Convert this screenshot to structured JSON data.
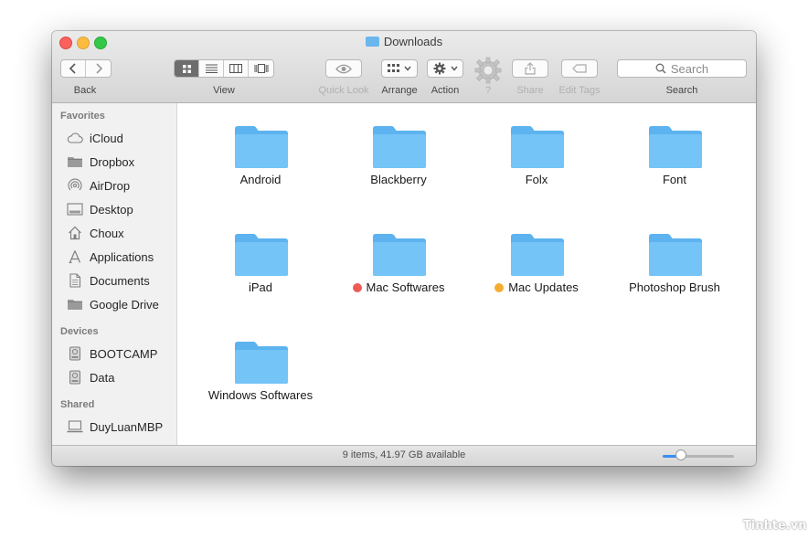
{
  "window": {
    "title": "Downloads"
  },
  "toolbar": {
    "back_label": "Back",
    "view_label": "View",
    "quicklook_label": "Quick Look",
    "arrange_label": "Arrange",
    "action_label": "Action",
    "unknown_label": "?",
    "share_label": "Share",
    "edittags_label": "Edit Tags",
    "search_label": "Search",
    "search_placeholder": "Search"
  },
  "sidebar": {
    "favorites_header": "Favorites",
    "favorites": [
      {
        "label": "iCloud",
        "icon": "cloud-icon"
      },
      {
        "label": "Dropbox",
        "icon": "folder-icon"
      },
      {
        "label": "AirDrop",
        "icon": "airdrop-icon"
      },
      {
        "label": "Desktop",
        "icon": "desktop-icon"
      },
      {
        "label": "Choux",
        "icon": "home-icon"
      },
      {
        "label": "Applications",
        "icon": "applications-icon"
      },
      {
        "label": "Documents",
        "icon": "documents-icon"
      },
      {
        "label": "Google Drive",
        "icon": "folder-icon"
      }
    ],
    "devices_header": "Devices",
    "devices": [
      {
        "label": "BOOTCAMP",
        "icon": "disk-icon"
      },
      {
        "label": "Data",
        "icon": "disk-icon"
      }
    ],
    "shared_header": "Shared",
    "shared": [
      {
        "label": "DuyLuanMBP",
        "icon": "computer-icon"
      }
    ]
  },
  "folders": [
    {
      "name": "Android",
      "tag": null
    },
    {
      "name": "Blackberry",
      "tag": null
    },
    {
      "name": "Folx",
      "tag": null
    },
    {
      "name": "Font",
      "tag": null
    },
    {
      "name": "iPad",
      "tag": null
    },
    {
      "name": "Mac Softwares",
      "tag": "#ec5b56"
    },
    {
      "name": "Mac Updates",
      "tag": "#f5ad30"
    },
    {
      "name": "Photoshop Brush",
      "tag": null
    },
    {
      "name": "Windows Softwares",
      "tag": null
    }
  ],
  "status": {
    "text": "9 items, 41.97 GB available",
    "icon_size_fraction": 0.25
  },
  "watermark": "Tinhte.vn",
  "colors": {
    "folder": "#6cc0f5",
    "accent": "#3b8df3"
  }
}
